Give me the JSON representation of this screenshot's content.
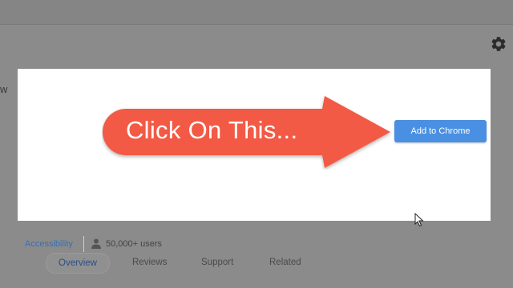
{
  "header": {
    "settings_icon": "gear-icon",
    "left_fragment": "w"
  },
  "callout": {
    "text": "Click On This...",
    "color": "#f25a45"
  },
  "add_button": {
    "label": "Add to Chrome",
    "color": "#4a90e2"
  },
  "meta": {
    "category": "Accessibility",
    "users_icon": "user-icon",
    "users": "50,000+ users"
  },
  "tabs": [
    {
      "label": "Overview",
      "active": true
    },
    {
      "label": "Reviews"
    },
    {
      "label": "Support"
    },
    {
      "label": "Related"
    }
  ]
}
